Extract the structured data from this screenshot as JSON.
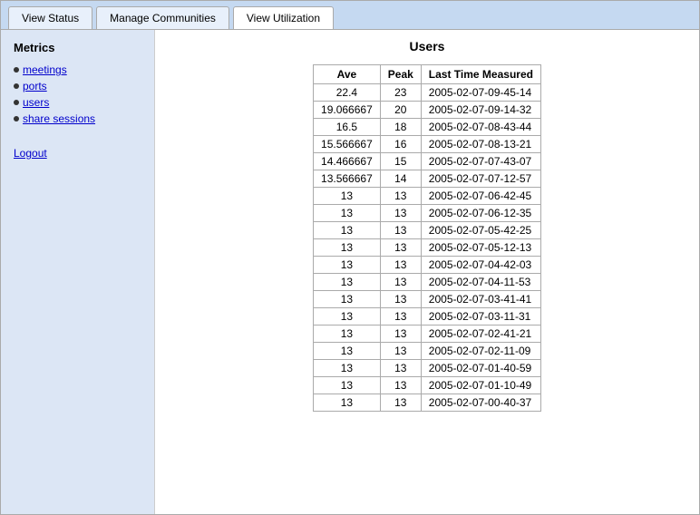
{
  "tabs": [
    {
      "label": "View Status",
      "active": false
    },
    {
      "label": "Manage Communities",
      "active": false
    },
    {
      "label": "View Utilization",
      "active": true
    }
  ],
  "sidebar": {
    "title": "Metrics",
    "nav_items": [
      {
        "label": "meetings",
        "href": "#"
      },
      {
        "label": "ports",
        "href": "#"
      },
      {
        "label": "users",
        "href": "#"
      },
      {
        "label": "share sessions",
        "href": "#"
      }
    ],
    "logout_label": "Logout"
  },
  "page_title": "Users",
  "table": {
    "headers": [
      "Ave",
      "Peak",
      "Last Time Measured"
    ],
    "rows": [
      {
        "ave": "22.4",
        "peak": "23",
        "last_time": "2005-02-07-09-45-14"
      },
      {
        "ave": "19.066667",
        "peak": "20",
        "last_time": "2005-02-07-09-14-32"
      },
      {
        "ave": "16.5",
        "peak": "18",
        "last_time": "2005-02-07-08-43-44"
      },
      {
        "ave": "15.566667",
        "peak": "16",
        "last_time": "2005-02-07-08-13-21"
      },
      {
        "ave": "14.466667",
        "peak": "15",
        "last_time": "2005-02-07-07-43-07"
      },
      {
        "ave": "13.566667",
        "peak": "14",
        "last_time": "2005-02-07-07-12-57"
      },
      {
        "ave": "13",
        "peak": "13",
        "last_time": "2005-02-07-06-42-45"
      },
      {
        "ave": "13",
        "peak": "13",
        "last_time": "2005-02-07-06-12-35"
      },
      {
        "ave": "13",
        "peak": "13",
        "last_time": "2005-02-07-05-42-25"
      },
      {
        "ave": "13",
        "peak": "13",
        "last_time": "2005-02-07-05-12-13"
      },
      {
        "ave": "13",
        "peak": "13",
        "last_time": "2005-02-07-04-42-03"
      },
      {
        "ave": "13",
        "peak": "13",
        "last_time": "2005-02-07-04-11-53"
      },
      {
        "ave": "13",
        "peak": "13",
        "last_time": "2005-02-07-03-41-41"
      },
      {
        "ave": "13",
        "peak": "13",
        "last_time": "2005-02-07-03-11-31"
      },
      {
        "ave": "13",
        "peak": "13",
        "last_time": "2005-02-07-02-41-21"
      },
      {
        "ave": "13",
        "peak": "13",
        "last_time": "2005-02-07-02-11-09"
      },
      {
        "ave": "13",
        "peak": "13",
        "last_time": "2005-02-07-01-40-59"
      },
      {
        "ave": "13",
        "peak": "13",
        "last_time": "2005-02-07-01-10-49"
      },
      {
        "ave": "13",
        "peak": "13",
        "last_time": "2005-02-07-00-40-37"
      }
    ]
  }
}
